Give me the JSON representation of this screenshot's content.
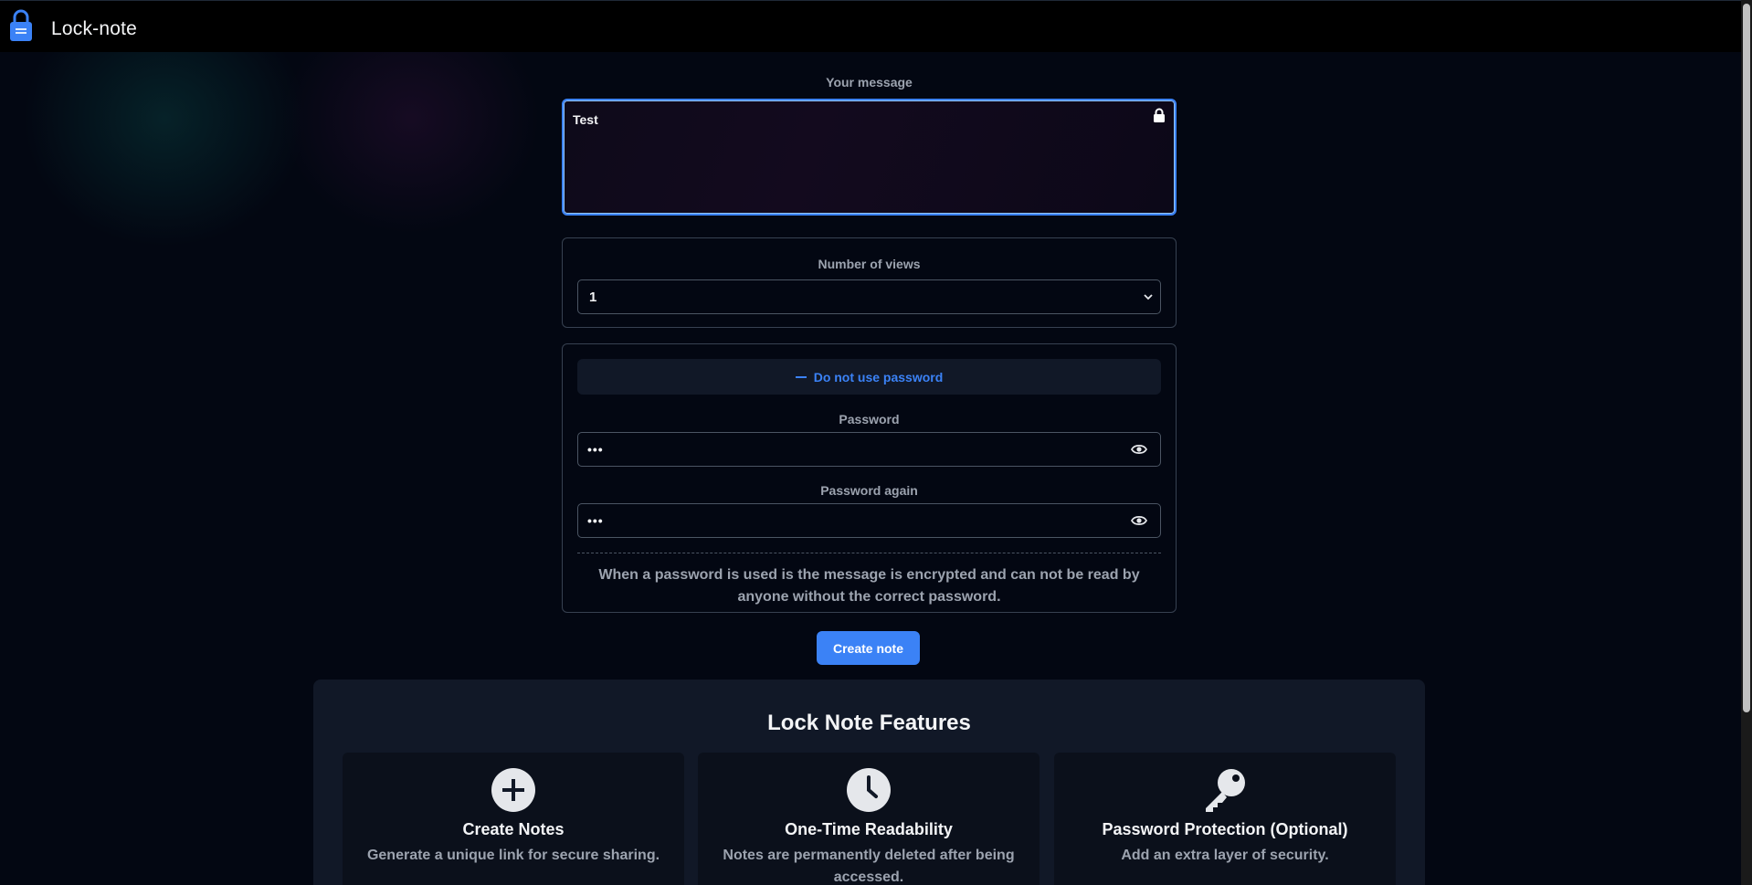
{
  "app": {
    "title": "Lock-note"
  },
  "message": {
    "label": "Your message",
    "value": "Test"
  },
  "views": {
    "label": "Number of views",
    "selected": "1"
  },
  "password": {
    "toggle_label": "Do not use password",
    "password_label": "Password",
    "password_value": "•••",
    "password_again_label": "Password again",
    "password_again_value": "•••",
    "hint": "When a password is used is the message is encrypted and can not be read by anyone without the correct password."
  },
  "actions": {
    "create_label": "Create note"
  },
  "features": {
    "heading": "Lock Note Features",
    "items": [
      {
        "icon": "plus-circle-icon",
        "title": "Create Notes",
        "desc": "Generate a unique link for secure sharing."
      },
      {
        "icon": "clock-icon",
        "title": "One-Time Readability",
        "desc": "Notes are permanently deleted after being accessed."
      },
      {
        "icon": "key-icon",
        "title": "Password Protection (Optional)",
        "desc": "Add an extra layer of security."
      }
    ]
  },
  "colors": {
    "accent": "#3b82f6",
    "background": "#030712",
    "panel": "#111827"
  }
}
